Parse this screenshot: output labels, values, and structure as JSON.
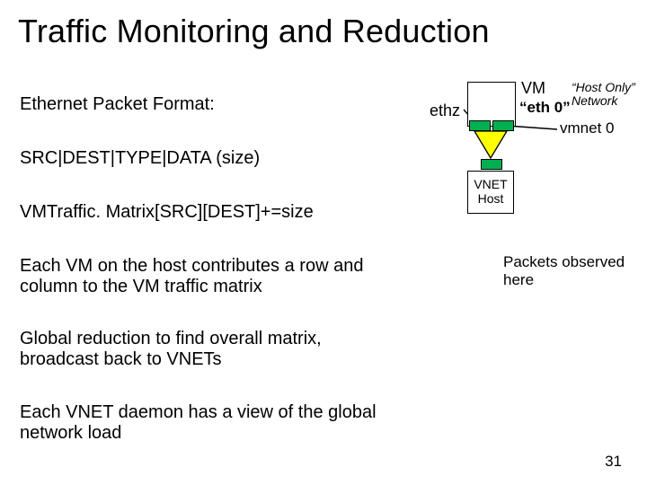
{
  "title": "Traffic Monitoring and Reduction",
  "lines": {
    "ethernet": "Ethernet Packet Format:",
    "srcdest": "SRC|DEST|TYPE|DATA  (size)",
    "vmtraffic": "VMTraffic. Matrix[SRC][DEST]+=size",
    "eachvm": "Each VM on the host contributes a row and column to the VM traffic matrix",
    "global": "Global reduction to find overall matrix, broadcast back to VNETs",
    "eachvnet": "Each VNET daemon has a view of the global network load"
  },
  "diagram": {
    "vm_label": "VM",
    "eth0": "“eth 0”",
    "host_only": "“Host Only” Network",
    "ethz": "ethz",
    "vmnet0": "vmnet 0",
    "vnet_line1": "VNET",
    "vnet_line2": "Host"
  },
  "packets_observed": "Packets observed here",
  "page_number": "31"
}
